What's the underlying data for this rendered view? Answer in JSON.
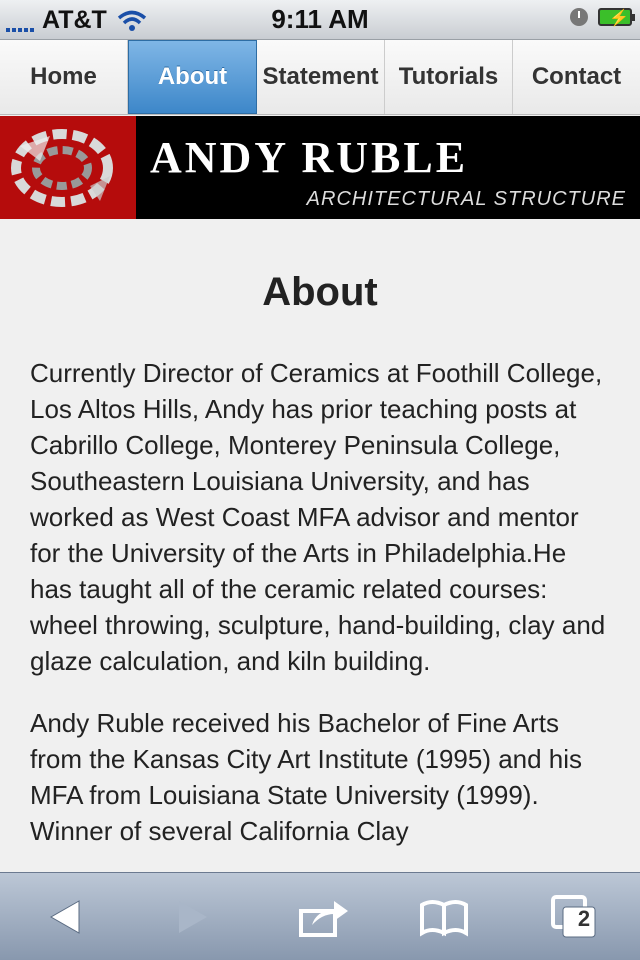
{
  "status_bar": {
    "carrier": "AT&T",
    "time": "9:11 AM",
    "icons": [
      "signal-icon",
      "wifi-icon",
      "clock-icon",
      "battery-icon"
    ]
  },
  "nav": {
    "items": [
      {
        "label": "Home"
      },
      {
        "label": "About",
        "active": true
      },
      {
        "label": "Statement"
      },
      {
        "label": "Tutorials"
      },
      {
        "label": "Contact"
      }
    ]
  },
  "banner": {
    "title": "ANDY RUBLE",
    "subtitle": "ARCHITECTURAL STRUCTURE"
  },
  "page": {
    "title": "About",
    "paragraphs": [
      "Currently Director of Ceramics at Foothill College, Los Altos Hills, Andy has prior teaching posts at Cabrillo College, Monterey Peninsula College, Southeastern Louisiana University, and has worked as West Coast MFA advisor and mentor for the University of the Arts in Philadelphia.He has taught all of the ceramic related courses: wheel throwing, sculpture, hand-building, clay and glaze calculation, and kiln building.",
      "Andy Ruble received his Bachelor of Fine Arts from the Kansas City Art Institute (1995) and his MFA from Louisiana State University (1999). Winner of several California Clay"
    ]
  },
  "toolbar": {
    "buttons": [
      "back-icon",
      "forward-icon",
      "share-icon",
      "bookmarks-icon",
      "tabs-icon"
    ],
    "tab_count": "2"
  },
  "colors": {
    "nav_active": "#3d87c9",
    "banner_red": "#c10d0d",
    "toolbar": "#8898ae"
  }
}
